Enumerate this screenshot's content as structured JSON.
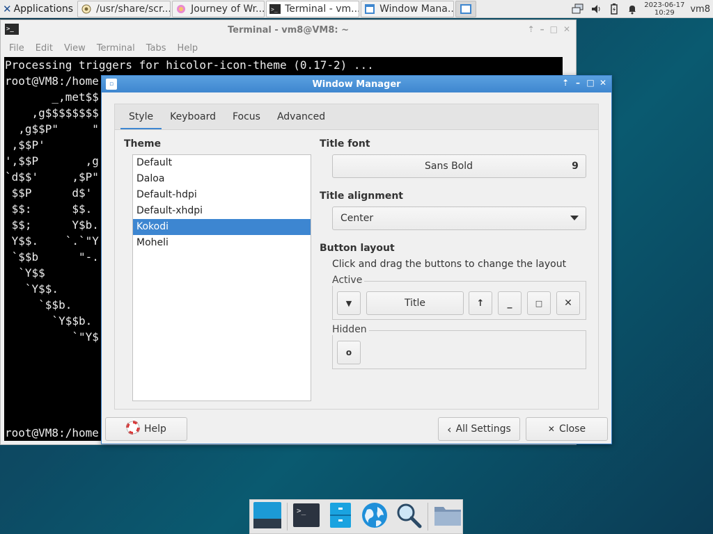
{
  "panel": {
    "apps_label": "Applications",
    "tasks": [
      {
        "label": "/usr/share/scr...",
        "icon": "browser-icon"
      },
      {
        "label": "Journey of Wr...",
        "icon": "firefox-icon"
      },
      {
        "label": "Terminal - vm...",
        "icon": "terminal-icon"
      },
      {
        "label": "Window Mana...",
        "icon": "window-manager-icon"
      }
    ],
    "date": "2023-06-17",
    "time": "10:29",
    "host": "vm8"
  },
  "terminal": {
    "title": "Terminal - vm8@VM8: ~",
    "menu": [
      "File",
      "Edit",
      "View",
      "Terminal",
      "Tabs",
      "Help"
    ],
    "lines": [
      "Processing triggers for hicolor-icon-theme (0.17-2) ...",
      "root@VM8:/home",
      "       _,met$$",
      "    ,g$$$$$$$$",
      "  ,g$$P\"     \"",
      " ,$$P'",
      "',$$P       ,g",
      "`d$$'     ,$P\"",
      " $$P      d$'",
      " $$:      $$.",
      " $$;      Y$b.",
      " Y$$.    `.`\"Y",
      " `$$b      \"-.",
      "  `Y$$",
      "   `Y$$.",
      "     `$$b.",
      "       `Y$$b.",
      "          `\"Y$",
      "",
      "",
      "",
      "",
      "",
      "root@VM8:/home"
    ]
  },
  "wm": {
    "title": "Window Manager",
    "tabs": [
      "Style",
      "Keyboard",
      "Focus",
      "Advanced"
    ],
    "theme_label": "Theme",
    "themes": [
      "Default",
      "Daloa",
      "Default-hdpi",
      "Default-xhdpi",
      "Kokodi",
      "Moheli"
    ],
    "selected_theme": "Kokodi",
    "title_font_label": "Title font",
    "title_font_name": "Sans Bold",
    "title_font_size": "9",
    "title_alignment_label": "Title alignment",
    "title_alignment_value": "Center",
    "button_layout_label": "Button layout",
    "button_layout_hint": "Click and drag the buttons to change the layout",
    "active_label": "Active",
    "title_button": "Title",
    "hidden_label": "Hidden",
    "help_label": "Help",
    "all_settings_label": "All Settings",
    "close_label": "Close"
  },
  "colors": {
    "accent": "#3d86d1",
    "desktop": "#0d4a63"
  }
}
